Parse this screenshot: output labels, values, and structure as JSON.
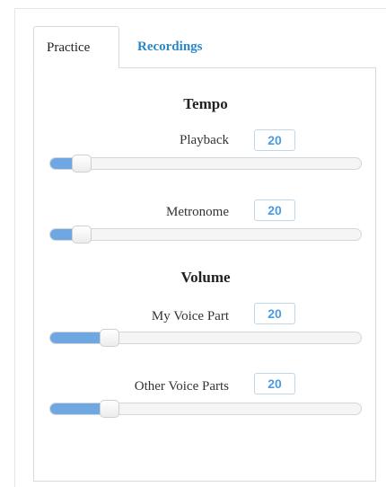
{
  "tabs": [
    {
      "label": "Practice",
      "active": true
    },
    {
      "label": "Recordings",
      "active": false
    }
  ],
  "sections": {
    "tempo": {
      "title": "Tempo",
      "controls": [
        {
          "label": "Playback",
          "value": "20",
          "level": 0.1
        },
        {
          "label": "Metronome",
          "value": "20",
          "level": 0.1
        }
      ]
    },
    "volume": {
      "title": "Volume",
      "controls": [
        {
          "label": "My Voice Part",
          "value": "20",
          "level": 0.19
        },
        {
          "label": "Other Voice Parts",
          "value": "20",
          "level": 0.19
        }
      ]
    }
  },
  "colors": {
    "accent": "#2a87c9",
    "slider_fill": "#6fa7e3",
    "value_text": "#4a9be0"
  }
}
